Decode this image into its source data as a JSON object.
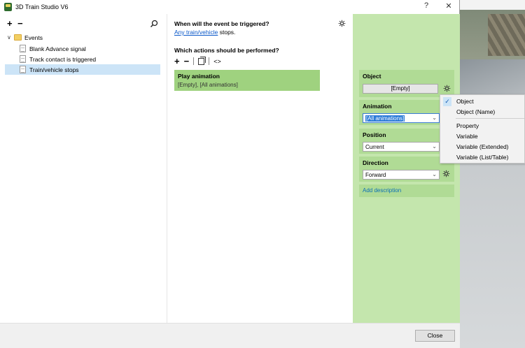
{
  "window": {
    "title": "3D Train Studio V6",
    "help_glyph": "?",
    "close_glyph": "✕"
  },
  "tree": {
    "add_glyph": "+",
    "remove_glyph": "−",
    "root": "Events",
    "items": [
      {
        "label": "Blank Advance signal"
      },
      {
        "label": "Track contact is triggered"
      },
      {
        "label": "Train/vehicle stops",
        "selected": true
      }
    ]
  },
  "trigger": {
    "question": "When will the event be triggered?",
    "link_text": "Any train/vehicle",
    "suffix": " stops."
  },
  "actions": {
    "question": "Which actions should be performed?",
    "add_glyph": "+",
    "remove_glyph": "−",
    "code_glyph": "<>",
    "card": {
      "title": "Play animation",
      "subtitle": "[Empty], [All animations]"
    }
  },
  "properties": {
    "object": {
      "label": "Object",
      "value": "[Empty]"
    },
    "animation": {
      "label": "Animation",
      "value": "[All animations]"
    },
    "position": {
      "label": "Position",
      "value": "Current"
    },
    "direction": {
      "label": "Direction",
      "value": "Forward"
    },
    "add_description": "Add description"
  },
  "menu": {
    "check_glyph": "✓",
    "items": [
      "Object",
      "Object (Name)",
      "Property",
      "Variable",
      "Variable (Extended)",
      "Variable (List/Table)"
    ]
  },
  "footer": {
    "close_label": "Close"
  },
  "colors": {
    "accent_green": "#9fd27f",
    "panel_green": "#c4e6ad",
    "link_blue": "#0a58c9",
    "selection_blue": "#cce4f7"
  }
}
